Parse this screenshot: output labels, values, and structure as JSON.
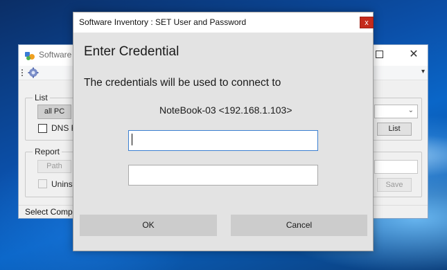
{
  "main_window": {
    "title": "Software",
    "list_group": {
      "legend": "List",
      "all_pc_button": "all PC",
      "dns_checkbox_label": "DNS R",
      "list_button": "List"
    },
    "report_group": {
      "legend": "Report",
      "path_button": "Path",
      "uninstall_checkbox_label": "Uninst",
      "save_button": "Save"
    },
    "status_text": "Select Compu"
  },
  "dialog": {
    "title": "Software Inventory : SET User and Password",
    "close_label": "x",
    "heading": "Enter Credential",
    "message": "The credentials will be used to connect to",
    "host": "NoteBook-03 <192.168.1.103>",
    "username_value": "",
    "password_value": "",
    "ok_label": "OK",
    "cancel_label": "Cancel"
  },
  "colors": {
    "close_button_red": "#c42b1c",
    "focus_border_blue": "#3b7fd1",
    "dialog_background": "#e3e3e3"
  }
}
